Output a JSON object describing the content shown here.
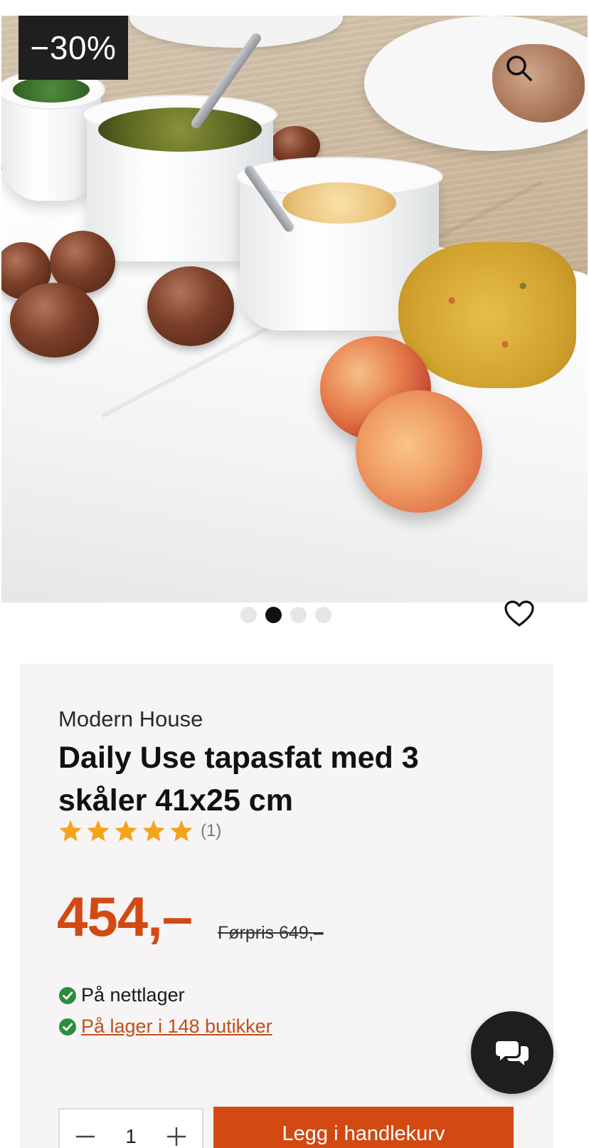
{
  "gallery": {
    "discount_badge": "−30%",
    "zoom_icon": "search-icon",
    "dots_total": 4,
    "active_dot": 1,
    "favorite_icon": "heart-outline-icon"
  },
  "product": {
    "brand": "Modern House",
    "title": "Daily Use tapasfat med 3 skåler 41x25 cm",
    "rating": {
      "stars": 5,
      "count_label": "(1)"
    },
    "price": "454,–",
    "old_price": "Førpris 649,–",
    "stock": {
      "online": "På nettlager",
      "stores_link": "På lager i 148 butikker"
    },
    "quantity": "1",
    "add_to_cart_label": "Legg i handlekurv"
  },
  "colors": {
    "accent": "#d24a12",
    "star": "#f5a31a",
    "check": "#2e8b3e",
    "badge_bg": "#1f1f1f"
  },
  "chat": {
    "icon": "chat-bubbles-icon"
  }
}
